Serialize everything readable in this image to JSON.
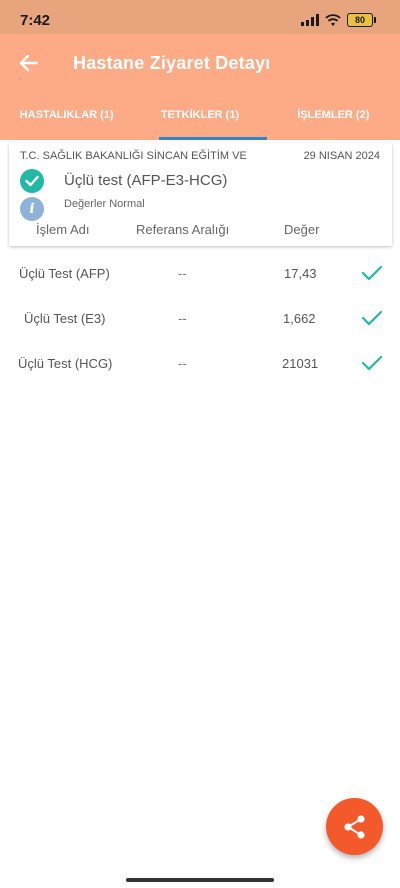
{
  "status_bar": {
    "time": "7:42",
    "battery": "80",
    "signal_icon": "signal-icon",
    "wifi_icon": "wifi-icon"
  },
  "header": {
    "title": "Hastane Ziyaret Detayı",
    "back_icon": "arrow-left-icon",
    "bg_color": "#fcab86"
  },
  "tabs": [
    {
      "label": "HASTALIKLAR (1)",
      "active": false
    },
    {
      "label": "TETKİKLER (1)",
      "active": true
    },
    {
      "label": "İŞLEMLER (2)",
      "active": false
    }
  ],
  "card": {
    "hospital": "T.C. SAĞLIK BAKANLIĞI SİNCAN EĞİTİM VE",
    "date": "29 NISAN 2024",
    "test_title": "Üçlü test (AFP-E3-HCG)",
    "status_note": "Değerler Normal",
    "columns": {
      "name": "İşlem Adı",
      "range": "Referans Aralığı",
      "value": "Değer"
    }
  },
  "results": [
    {
      "name": "Üçlü Test (AFP)",
      "range": "--",
      "value": "17,43"
    },
    {
      "name": "Üçlü Test (E3)",
      "range": "--",
      "value": "1,662"
    },
    {
      "name": "Üçlü Test (HCG)",
      "range": "--",
      "value": "21031"
    }
  ],
  "colors": {
    "accent_teal": "#21b8a6",
    "fab": "#f4592b",
    "tab_indicator": "#2a86c8"
  },
  "fab": {
    "icon": "share-icon"
  }
}
